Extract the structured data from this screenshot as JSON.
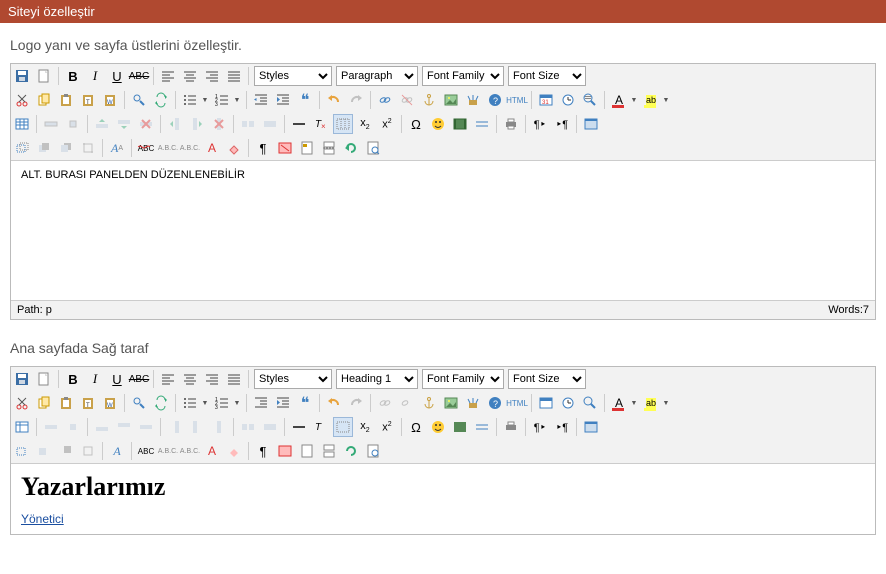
{
  "header": {
    "title": "Siteyi özelleştir"
  },
  "section1": {
    "title": "Logo yanı ve sayfa üstlerini özelleştir.",
    "styles": "Styles",
    "paragraph": "Paragraph",
    "fontfamily": "Font Family",
    "fontsize": "Font Size",
    "content": "ALT. BURASI PANELDEN DÜZENLENEBİLİR",
    "path": "Path: p",
    "words": "Words:7"
  },
  "section2": {
    "title": "Ana sayfada Sağ taraf",
    "styles": "Styles",
    "paragraph": "Heading 1",
    "fontfamily": "Font Family",
    "fontsize": "Font Size",
    "heading": "Yazarlarımız",
    "link1": "Yönetici"
  }
}
